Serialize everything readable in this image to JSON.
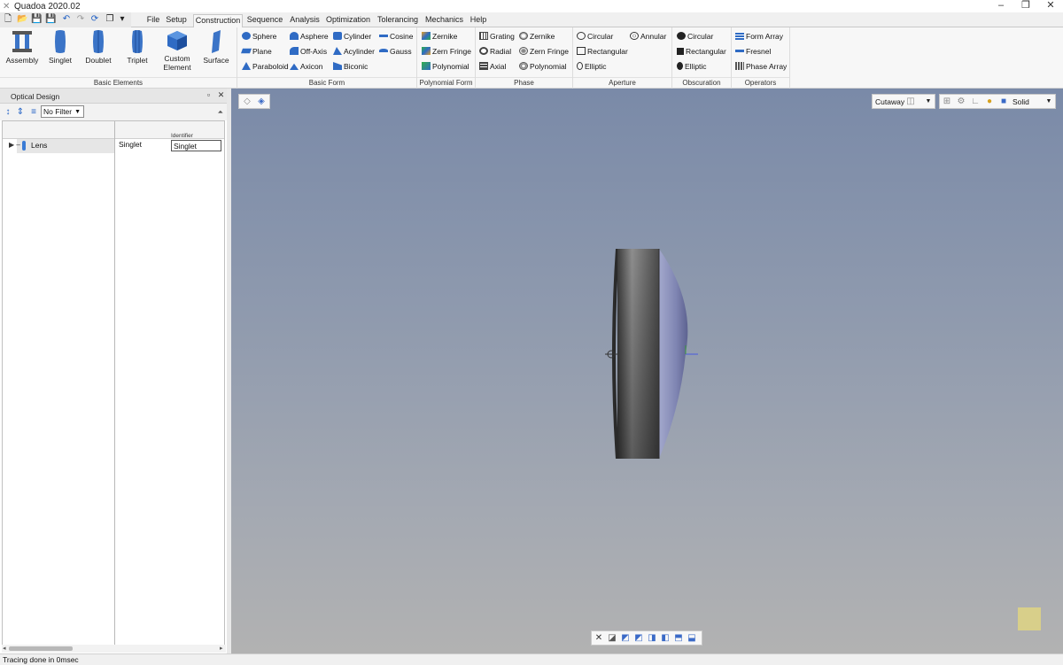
{
  "app": {
    "title": "Quadoa 2020.02"
  },
  "window_controls": {
    "minimize": "–",
    "restore": "❐",
    "close": "✕"
  },
  "quick_access": [
    {
      "icon": "new-file-icon",
      "glyph": "🗋"
    },
    {
      "icon": "open-folder-icon",
      "glyph": "📂"
    },
    {
      "icon": "save-icon",
      "glyph": "💾"
    },
    {
      "icon": "save-as-icon",
      "glyph": "💾"
    },
    {
      "icon": "undo-icon",
      "glyph": "↶"
    },
    {
      "icon": "redo-icon",
      "glyph": "↷"
    },
    {
      "icon": "refresh-icon",
      "glyph": "⟳"
    },
    {
      "icon": "copy-icon",
      "glyph": "❐"
    },
    {
      "icon": "dropdown-icon",
      "glyph": "▾"
    }
  ],
  "menu_tabs": [
    "File",
    "Setup",
    "Construction",
    "Sequence",
    "Analysis",
    "Optimization",
    "Tolerancing",
    "Mechanics",
    "Help"
  ],
  "active_tab": "Construction",
  "ribbon": {
    "basic_elements": {
      "label": "Basic Elements",
      "buttons": [
        "Assembly",
        "Singlet",
        "Doublet",
        "Triplet",
        "Custom Element",
        "Surface"
      ]
    },
    "basic_form": {
      "label": "Basic Form",
      "col1": [
        "Sphere",
        "Plane",
        "Paraboloid"
      ],
      "col2": [
        "Asphere",
        "Off-Axis",
        "Axicon"
      ],
      "col3": [
        "Cylinder",
        "Acylinder",
        "Biconic"
      ],
      "col4": [
        "Cosine",
        "Gauss"
      ]
    },
    "polynomial_form": {
      "label": "Polynomial Form",
      "items": [
        "Zernike",
        "Zern Fringe",
        "Polynomial"
      ]
    },
    "phase": {
      "label": "Phase",
      "col1": [
        "Grating",
        "Radial",
        "Axial"
      ],
      "col2": [
        "Zernike",
        "Zern Fringe",
        "Polynomial"
      ]
    },
    "aperture": {
      "label": "Aperture",
      "col1": [
        "Circular",
        "Rectangular",
        "Elliptic"
      ],
      "col2": [
        "Annular"
      ]
    },
    "obscuration": {
      "label": "Obscuration",
      "items": [
        "Circular",
        "Rectangular",
        "Elliptic"
      ]
    },
    "operators": {
      "label": "Operators",
      "items": [
        "Form Array",
        "Fresnel",
        "Phase Array"
      ]
    }
  },
  "optical_design": {
    "title": "Optical Design",
    "filter_value": "No Filter",
    "column_header_identifier": "Identifier",
    "rows": [
      {
        "name": "Lens",
        "type": "Singlet",
        "identifier": "Singlet"
      }
    ]
  },
  "viewport": {
    "cutaway_label": "Cutaway",
    "render_mode": "Solid"
  },
  "status": {
    "text": "Tracing done in 0msec"
  },
  "colors": {
    "accent": "#1f5fc4",
    "viewport_top": "#7a8aa8",
    "viewport_bottom": "#b2b2b2"
  }
}
